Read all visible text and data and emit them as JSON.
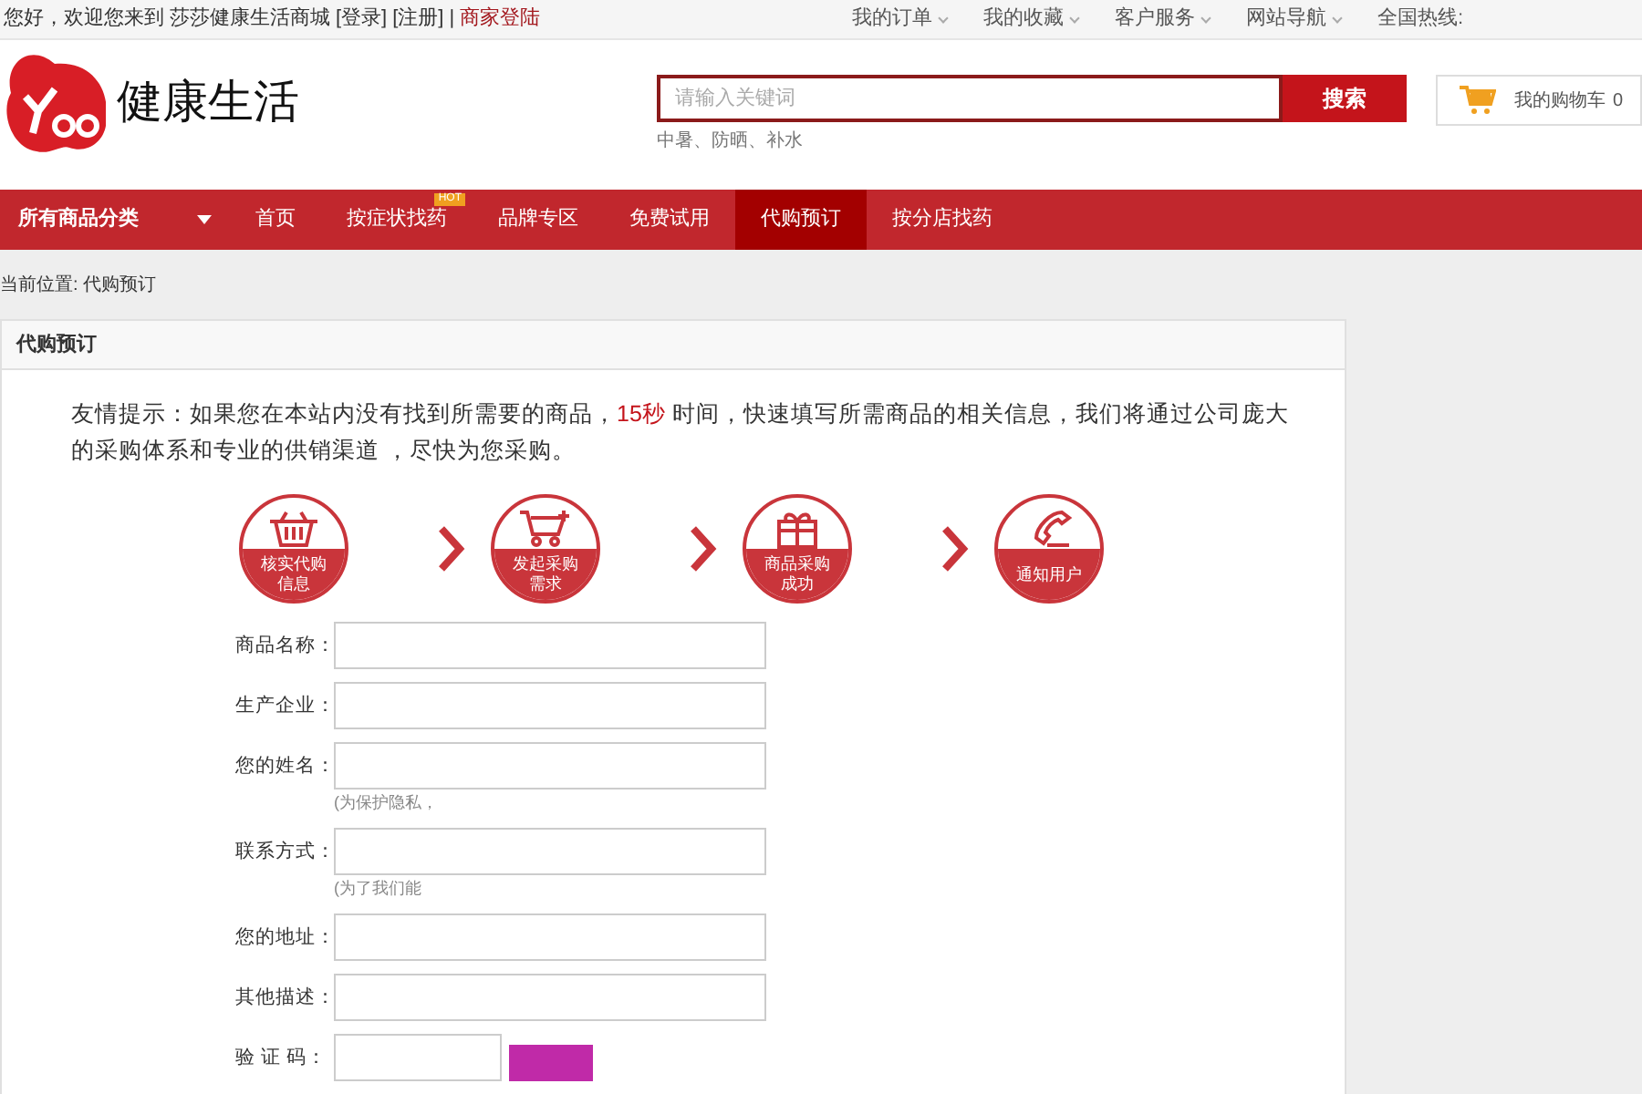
{
  "top_bar": {
    "greeting": "您好，欢迎您来到",
    "site_name": "莎莎健康生活商城",
    "login": "[登录]",
    "register": "[注册]",
    "separator": "|",
    "merchant_login": "商家登陆",
    "links": [
      {
        "label": "我的订单",
        "dropdown": true
      },
      {
        "label": "我的收藏",
        "dropdown": true
      },
      {
        "label": "客户服务",
        "dropdown": true
      },
      {
        "label": "网站导航",
        "dropdown": true
      },
      {
        "label": "全国热线:",
        "dropdown": false
      }
    ]
  },
  "header": {
    "logo_text": "健康生活",
    "search": {
      "placeholder": "请输入关键词",
      "button": "搜索",
      "hot_words": "中暑、防晒、补水"
    },
    "cart": {
      "label": "我的购物车",
      "count": "0"
    }
  },
  "nav": {
    "category": "所有商品分类",
    "items": [
      {
        "label": "首页",
        "selected": false
      },
      {
        "label": "按症状找药",
        "selected": false,
        "badge": "HOT"
      },
      {
        "label": "品牌专区",
        "selected": false
      },
      {
        "label": "免费试用",
        "selected": false
      },
      {
        "label": "代购预订",
        "selected": true
      },
      {
        "label": "按分店找药",
        "selected": false
      }
    ]
  },
  "breadcrumb": "当前位置: 代购预订",
  "panel": {
    "title": "代购预订",
    "tip": {
      "before": "友情提示：如果您在本站内没有找到所需要的商品，",
      "highlight": "15秒",
      "after": " 时间，快速填写所需商品的相关信息，我们将通过公司庞大的采购体系和专业的供销渠道 ，尽快为您采购。"
    },
    "steps": [
      {
        "kind": "basket",
        "label": "核实代购信息"
      },
      {
        "kind": "cart",
        "label": "发起采购需求"
      },
      {
        "kind": "gift",
        "label": "商品采购成功"
      },
      {
        "kind": "phone",
        "label": "通知用户"
      }
    ],
    "form": [
      {
        "label": "商品名称："
      },
      {
        "label": "生产企业："
      },
      {
        "label": "您的姓名：",
        "hint": "(为保护隐私，"
      },
      {
        "label": "联系方式：",
        "hint": "(为了我们能"
      },
      {
        "label": "您的地址："
      },
      {
        "label": "其他描述："
      },
      {
        "label": "验 证 码：",
        "kind": "captcha"
      }
    ]
  }
}
